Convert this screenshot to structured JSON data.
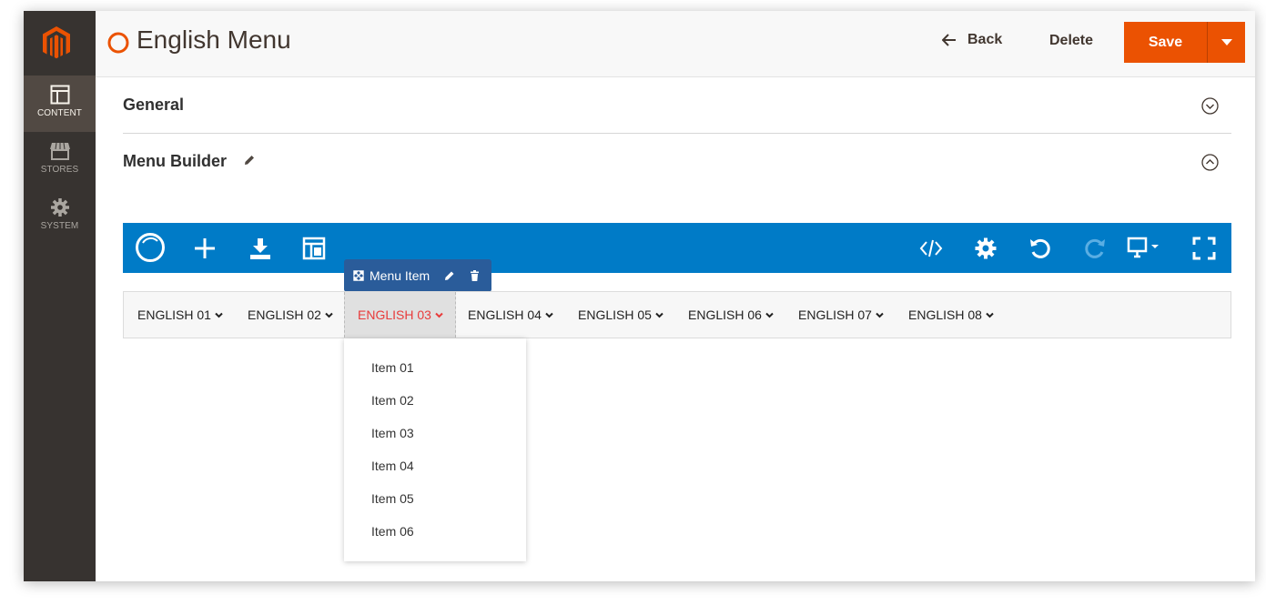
{
  "sidebar": {
    "items": [
      {
        "label": "CONTENT",
        "icon": "content-icon",
        "active": true
      },
      {
        "label": "STORES",
        "icon": "stores-icon",
        "active": false
      },
      {
        "label": "SYSTEM",
        "icon": "gear-icon",
        "active": false
      }
    ]
  },
  "header": {
    "title": "English Menu",
    "back_label": "Back",
    "delete_label": "Delete",
    "save_label": "Save"
  },
  "sections": {
    "general": "General",
    "menu_builder": "Menu Builder"
  },
  "item_tag": {
    "label": "Menu Item"
  },
  "menu": {
    "entries": [
      "ENGLISH 01",
      "ENGLISH 02",
      "ENGLISH 03",
      "ENGLISH 04",
      "ENGLISH 05",
      "ENGLISH 06",
      "ENGLISH 07",
      "ENGLISH 08"
    ],
    "active_index": 2,
    "dropdown_items": [
      "Item 01",
      "Item 02",
      "Item 03",
      "Item 04",
      "Item 05",
      "Item 06"
    ]
  },
  "colors": {
    "accent": "#eb5202",
    "toolbar": "#007bc7",
    "sidebar": "#373330",
    "active_menu_text": "#e83b3b",
    "tag": "#2a5c9a"
  }
}
